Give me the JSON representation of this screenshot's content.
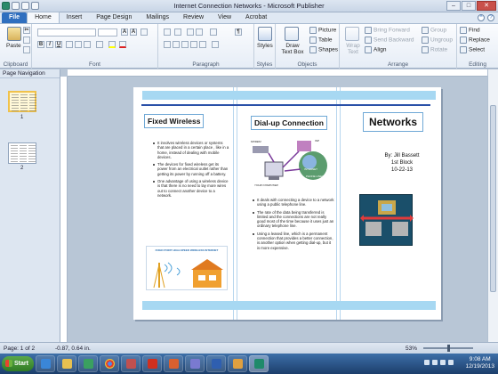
{
  "window": {
    "title": "Internet Connection Networks - Microsoft Publisher"
  },
  "tabs": [
    {
      "label": "File"
    },
    {
      "label": "Home"
    },
    {
      "label": "Insert"
    },
    {
      "label": "Page Design"
    },
    {
      "label": "Mailings"
    },
    {
      "label": "Review"
    },
    {
      "label": "View"
    },
    {
      "label": "Acrobat"
    }
  ],
  "ribbon": {
    "clipboard": {
      "label": "Clipboard",
      "paste": "Paste"
    },
    "font": {
      "label": "Font",
      "bold": "B",
      "italic": "I",
      "underline": "U"
    },
    "paragraph": {
      "label": "Paragraph"
    },
    "styles": {
      "label": "Styles",
      "button": "Styles"
    },
    "objects": {
      "label": "Objects",
      "draw_text_box": "Draw Text Box",
      "picture": "Picture",
      "table": "Table",
      "shapes": "Shapes"
    },
    "arrange": {
      "label": "Arrange",
      "wrap_text": "Wrap Text",
      "bring_forward": "Bring Forward",
      "send_backward": "Send Backward",
      "align": "Align",
      "group": "Group",
      "ungroup": "Ungroup",
      "rotate": "Rotate"
    },
    "editing": {
      "label": "Editing",
      "find": "Find",
      "replace": "Replace",
      "select": "Select"
    }
  },
  "navigation": {
    "title": "Page Navigation",
    "pages": [
      "1",
      "2"
    ]
  },
  "document": {
    "col1": {
      "heading": "Fixed Wireless",
      "bullets": [
        "It involves wireless devices or systems that are placed in a certain place , like in a home, instead of dealing with mobile devices.",
        "The devices for fixed wireless get its power from an electrical outlet rather than getting its power by running off a battery.",
        "One advantage of using a wireless device is that there is no need to lay more wires out to connect another device to a network."
      ],
      "diagram_caption": "FIXED POINT HIGH-SPEED WIRELESS INTERNET"
    },
    "col2": {
      "heading": "Dial-up Connection",
      "labels": {
        "modem": "MODEM",
        "isp": "ISP",
        "computer": "YOUR COMPUTER",
        "internet": "INTERNET",
        "phone": "PHONE LINES"
      },
      "bullets": [
        "It deals with connecting a device to a network using a public telephone line.",
        "The rate of the data being transferred is limited and the connections are not really good most of the time because it uses just an ordinary telephone line.",
        "Using a leased line, which is a permanent connection that provides a better connection, is another option when getting dial-up, but it is more expensive."
      ]
    },
    "col3": {
      "heading": "Networks",
      "author": "By: Jill Bassett",
      "class": "1st Block",
      "date": "10-22-13"
    }
  },
  "status": {
    "page": "Page: 1 of 2",
    "position": "-0.87, 0.64 in.",
    "zoom": "53%"
  },
  "taskbar": {
    "start": "Start",
    "time": "9:08 AM",
    "date": "12/19/2013"
  }
}
